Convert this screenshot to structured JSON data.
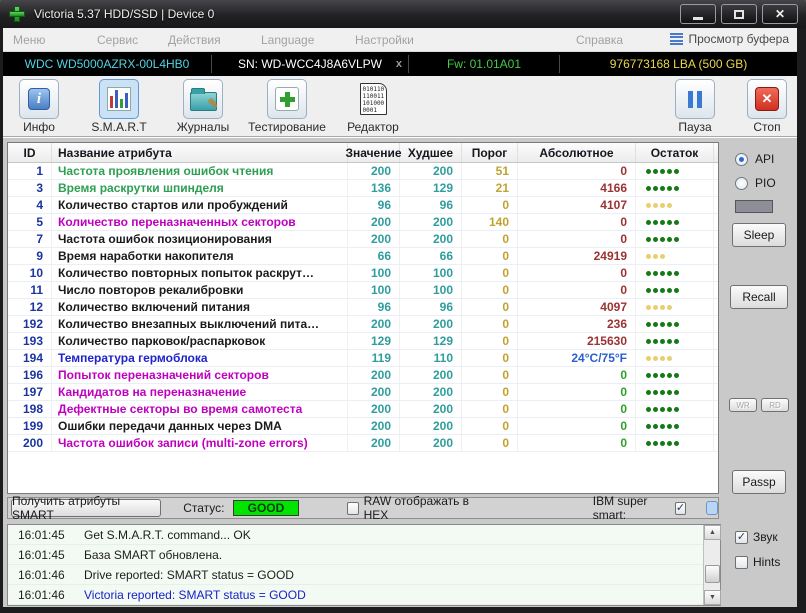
{
  "window": {
    "title": "Victoria 5.37 HDD/SSD | Device 0",
    "close_glyph": "✕"
  },
  "menu": {
    "items": [
      "Меню",
      "Сервис",
      "Действия",
      "Language",
      "Настройки",
      "Справка"
    ],
    "buffer_view": "Просмотр буфера"
  },
  "device_bar": {
    "model": "WDC WD5000AZRX-00L4HB0",
    "sn": "SN: WD-WCC4J8A6VLPW",
    "sn_close": "x",
    "fw": "Fw: 01.01A01",
    "capacity": "976773168 LBA (500 GB)"
  },
  "toolbar": {
    "items": [
      {
        "label": "Инфо"
      },
      {
        "label": "S.M.A.R.T",
        "selected": true
      },
      {
        "label": "Журналы"
      },
      {
        "label": "Тестирование"
      },
      {
        "label": "Редактор"
      }
    ],
    "editor_icon_text": "010110 110011 101000 0001",
    "pause": "Пауза",
    "stop": "Стоп"
  },
  "smart_table": {
    "columns": [
      "ID",
      "Название атрибута",
      "Значение",
      "Худшее",
      "Порог",
      "Абсолютное",
      "Остаток"
    ],
    "rows": [
      {
        "id": 1,
        "name": "Частота проявления ошибок чтения",
        "name_color": "green",
        "value": 200,
        "worst": 200,
        "threshold": 51,
        "absolute": "0",
        "abs_color": "red",
        "dots": {
          "count": 5,
          "color": "green"
        }
      },
      {
        "id": 3,
        "name": "Время раскрутки шпинделя",
        "name_color": "green",
        "value": 136,
        "worst": 129,
        "threshold": 21,
        "absolute": "4166",
        "abs_color": "red",
        "dots": {
          "count": 5,
          "color": "green"
        }
      },
      {
        "id": 4,
        "name": "Количество стартов или пробуждений",
        "name_color": "black",
        "value": 96,
        "worst": 96,
        "threshold": 0,
        "absolute": "4107",
        "abs_color": "red",
        "dots": {
          "count": 4,
          "color": "yellow"
        }
      },
      {
        "id": 5,
        "name": "Количество переназначенных секторов",
        "name_color": "magenta",
        "value": 200,
        "worst": 200,
        "threshold": 140,
        "absolute": "0",
        "abs_color": "red",
        "dots": {
          "count": 5,
          "color": "green"
        }
      },
      {
        "id": 7,
        "name": "Частота ошибок позиционирования",
        "name_color": "black",
        "value": 200,
        "worst": 200,
        "threshold": 0,
        "absolute": "0",
        "abs_color": "red",
        "dots": {
          "count": 5,
          "color": "green"
        }
      },
      {
        "id": 9,
        "name": "Время наработки накопителя",
        "name_color": "black",
        "value": 66,
        "worst": 66,
        "threshold": 0,
        "absolute": "24919",
        "abs_color": "red",
        "dots": {
          "count": 3,
          "color": "yellow"
        }
      },
      {
        "id": 10,
        "name": "Количество повторных попыток раскрут…",
        "name_color": "black",
        "value": 100,
        "worst": 100,
        "threshold": 0,
        "absolute": "0",
        "abs_color": "red",
        "dots": {
          "count": 5,
          "color": "green"
        }
      },
      {
        "id": 11,
        "name": "Число повторов рекалибровки",
        "name_color": "black",
        "value": 100,
        "worst": 100,
        "threshold": 0,
        "absolute": "0",
        "abs_color": "red",
        "dots": {
          "count": 5,
          "color": "green"
        }
      },
      {
        "id": 12,
        "name": "Количество включений питания",
        "name_color": "black",
        "value": 96,
        "worst": 96,
        "threshold": 0,
        "absolute": "4097",
        "abs_color": "red",
        "dots": {
          "count": 4,
          "color": "yellow"
        }
      },
      {
        "id": 192,
        "name": "Количество внезапных выключений пита…",
        "name_color": "black",
        "value": 200,
        "worst": 200,
        "threshold": 0,
        "absolute": "236",
        "abs_color": "red",
        "dots": {
          "count": 5,
          "color": "green"
        }
      },
      {
        "id": 193,
        "name": "Количество парковок/распарковок",
        "name_color": "black",
        "value": 129,
        "worst": 129,
        "threshold": 0,
        "absolute": "215630",
        "abs_color": "red",
        "dots": {
          "count": 5,
          "color": "green"
        }
      },
      {
        "id": 194,
        "name": "Температура гермоблока",
        "name_color": "blue",
        "value": 119,
        "worst": 110,
        "threshold": 0,
        "absolute": "24°C/75°F",
        "abs_color": "blue",
        "dots": {
          "count": 4,
          "color": "yellow"
        }
      },
      {
        "id": 196,
        "name": "Попыток переназначений секторов",
        "name_color": "magenta",
        "value": 200,
        "worst": 200,
        "threshold": 0,
        "absolute": "0",
        "abs_color": "green",
        "dots": {
          "count": 5,
          "color": "green"
        }
      },
      {
        "id": 197,
        "name": "Кандидатов на переназначение",
        "name_color": "magenta",
        "value": 200,
        "worst": 200,
        "threshold": 0,
        "absolute": "0",
        "abs_color": "green",
        "dots": {
          "count": 5,
          "color": "green"
        }
      },
      {
        "id": 198,
        "name": "Дефектные секторы во время самотеста",
        "name_color": "magenta",
        "value": 200,
        "worst": 200,
        "threshold": 0,
        "absolute": "0",
        "abs_color": "green",
        "dots": {
          "count": 5,
          "color": "green"
        }
      },
      {
        "id": 199,
        "name": "Ошибки передачи данных через DMA",
        "name_color": "black",
        "value": 200,
        "worst": 200,
        "threshold": 0,
        "absolute": "0",
        "abs_color": "green",
        "dots": {
          "count": 5,
          "color": "green"
        }
      },
      {
        "id": 200,
        "name": "Частота ошибок записи (multi-zone errors)",
        "name_color": "magenta",
        "value": 200,
        "worst": 200,
        "threshold": 0,
        "absolute": "0",
        "abs_color": "green",
        "dots": {
          "count": 5,
          "color": "green"
        }
      }
    ]
  },
  "status_bar": {
    "get_smart_button": "Получить атрибуты SMART",
    "status_label": "Статус:",
    "status_value": "GOOD",
    "raw_checkbox_label": "RAW отображать в HEX",
    "ibm_label": "IBM super smart:",
    "check_glyph": "✓"
  },
  "sidebar": {
    "api_label": "API",
    "pio_label": "PIO",
    "sleep_button": "Sleep",
    "recall_button": "Recall",
    "small_button_1": "WR",
    "small_button_2": "RD",
    "passp_button": "Passp",
    "sound_label": "Звук",
    "hints_label": "Hints",
    "check_glyph": "✓"
  },
  "log": {
    "entries": [
      {
        "time": "16:01:45",
        "text": "Get S.M.A.R.T. command... OK",
        "color": "black"
      },
      {
        "time": "16:01:45",
        "text": "База SMART обновлена.",
        "color": "black"
      },
      {
        "time": "16:01:46",
        "text": "Drive reported: SMART status = GOOD",
        "color": "black"
      },
      {
        "time": "16:01:46",
        "text": "Victoria reported: SMART status = GOOD",
        "color": "blue"
      }
    ]
  },
  "colors": {
    "id_color": "#1a35a0",
    "names": {
      "green": "#2d9e52",
      "magenta": "#bf00bf",
      "blue": "#2222cc",
      "black": "#1a1a1a"
    },
    "value_color": "#2f9d9d",
    "threshold_color": "#bfa332",
    "abs_colors": {
      "red": "#9c3232",
      "green": "#2fa02f",
      "blue": "#2a5fd0"
    },
    "dot_colors": {
      "green": "#157a15",
      "yellow": "#e8cf6e"
    },
    "status_good_bg": "#00e400",
    "model": "#4fd4e4",
    "fw": "#44cc44",
    "capacity": "#e8d84a",
    "log": {
      "black": "#1c1c1c",
      "blue": "#1822c8"
    }
  }
}
